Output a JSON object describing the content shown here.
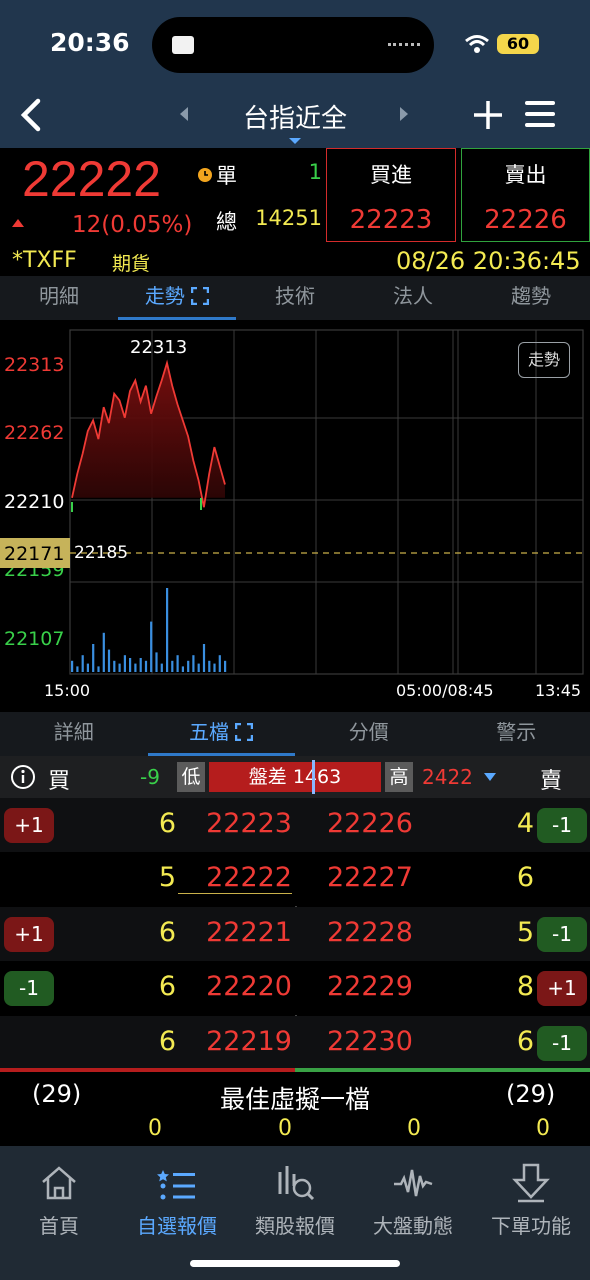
{
  "status": {
    "time": "20:36",
    "battery": "60"
  },
  "nav": {
    "title": "台指近全"
  },
  "quote": {
    "last": "22222",
    "change": "12",
    "change_pct": "(0.05%)",
    "single_label": "單",
    "single_value": "1",
    "total_label": "總",
    "total_value": "14251",
    "buy_label": "買進",
    "buy_price": "22223",
    "sell_label": "賣出",
    "sell_price": "22226",
    "symbol": "*TXFF",
    "type": "期貨",
    "datetime": "08/26 20:36:45"
  },
  "tabs_top": [
    "明細",
    "走勢",
    "技術",
    "法人",
    "趨勢"
  ],
  "chart": {
    "y_labels": [
      "22313",
      "22262",
      "22210",
      "22171",
      "22159",
      "22107"
    ],
    "high_label": "22313",
    "ref_label": "22185",
    "time_labels": [
      "15:00",
      "05:00/08:45",
      "13:45"
    ],
    "badge": "走勢"
  },
  "chart_data": {
    "type": "line",
    "series": [
      {
        "values": [
          22212,
          22230,
          22245,
          22262,
          22270,
          22256,
          22280,
          22268,
          22290,
          22285,
          22272,
          22292,
          22300,
          22284,
          22296,
          22275,
          22288,
          22300,
          22313,
          22296,
          22282,
          22270,
          22258,
          22240,
          22225,
          22205,
          22230,
          22250,
          22236,
          22222
        ]
      }
    ],
    "volume": [
      4,
      2,
      6,
      3,
      10,
      2,
      14,
      8,
      4,
      3,
      6,
      5,
      3,
      5,
      4,
      18,
      7,
      3,
      30,
      4,
      6,
      2,
      4,
      6,
      3,
      10,
      4,
      3,
      6,
      4
    ]
  },
  "tabs_book": [
    "詳細",
    "五檔",
    "分價",
    "警示"
  ],
  "book_header": {
    "buy": "買",
    "buy_delta": "-9",
    "low_label": "低",
    "spread": "盤差 1463",
    "high_label": "高",
    "high_value": "2422",
    "sell": "賣"
  },
  "book_rows": [
    {
      "bchip": "+1",
      "bqty": "6",
      "bprice": "22223",
      "sprice": "22226",
      "sqty": "4",
      "schip": "-1"
    },
    {
      "bchip": "",
      "bqty": "5",
      "bprice": "22222",
      "sprice": "22227",
      "sqty": "6",
      "schip": ""
    },
    {
      "bchip": "+1",
      "bqty": "6",
      "bprice": "22221",
      "sprice": "22228",
      "sqty": "5",
      "schip": "-1"
    },
    {
      "bchip": "-1",
      "bqty": "6",
      "bprice": "22220",
      "sprice": "22229",
      "sqty": "8",
      "schip": "+1"
    },
    {
      "bchip": "",
      "bqty": "6",
      "bprice": "22219",
      "sprice": "22230",
      "sqty": "6",
      "schip": "-1"
    }
  ],
  "virtual": {
    "left": "(29)",
    "title": "最佳虛擬一檔",
    "right": "(29)",
    "v1": "0",
    "v2": "0",
    "v3": "0",
    "v4": "0"
  },
  "bottom_nav": [
    "首頁",
    "自選報價",
    "類股報價",
    "大盤動態",
    "下單功能"
  ],
  "colors": {
    "red": "#ef3a35",
    "green": "#39d04a",
    "yellow": "#f3ea52",
    "blue": "#5ba9ff"
  }
}
